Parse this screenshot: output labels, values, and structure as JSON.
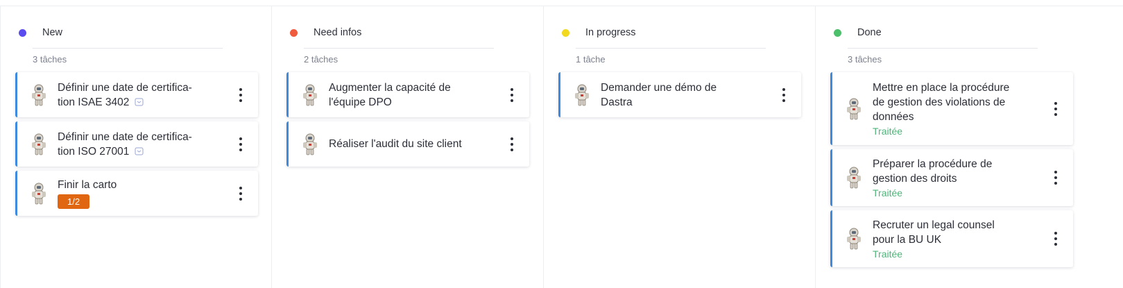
{
  "columns": [
    {
      "title": "New",
      "color": "#5b4cf0",
      "count": "3 tâches",
      "cards": [
        {
          "title_line1": "Définir une date de certifica-",
          "title_line2": "tion ISAE 3402"
        },
        {
          "title_line1": "Définir une date de certifica-",
          "title_line2": "tion ISO 27001"
        },
        {
          "title_line1": "Finir la carto",
          "badge": "1/2"
        }
      ]
    },
    {
      "title": "Need infos",
      "color": "#f05a3d",
      "count": "2 tâches",
      "cards": [
        {
          "title_line1": "Augmenter la capacité de",
          "title_line2": "l'équipe DPO"
        },
        {
          "title_line1": "Réaliser l'audit du site client"
        }
      ]
    },
    {
      "title": "In progress",
      "color": "#f2d91f",
      "count": "1 tâche",
      "cards": [
        {
          "title_line1": "Demander une démo de",
          "title_line2": "Dastra"
        }
      ]
    },
    {
      "title": "Done",
      "color": "#4cbf6b",
      "count": "3 tâches",
      "cards": [
        {
          "title_line1": "Mettre en place la procédure",
          "title_line2": "de gestion des violations de",
          "title_line3": "données",
          "status": "Traitée"
        },
        {
          "title_line1": "Préparer la procédure de",
          "title_line2": "gestion des droits",
          "status": "Traitée"
        },
        {
          "title_line1": "Recruter un legal counsel",
          "title_line2": "pour la BU UK",
          "status": "Traitée"
        }
      ]
    }
  ],
  "icons": {
    "avatar": "astronaut-avatar-icon",
    "linked": "link-shield-icon",
    "menu": "more-vertical-icon"
  }
}
